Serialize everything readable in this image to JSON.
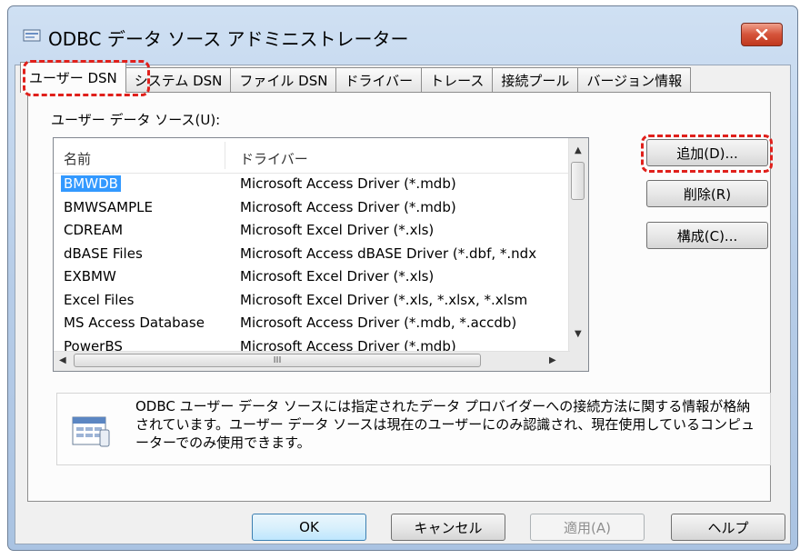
{
  "window": {
    "title": "ODBC データ ソース アドミニストレーター",
    "close_glyph": "✕"
  },
  "tabs": [
    {
      "label": "ユーザー DSN",
      "active": true
    },
    {
      "label": "システム DSN",
      "active": false
    },
    {
      "label": "ファイル DSN",
      "active": false
    },
    {
      "label": "ドライバー",
      "active": false
    },
    {
      "label": "トレース",
      "active": false
    },
    {
      "label": "接続プール",
      "active": false
    },
    {
      "label": "バージョン情報",
      "active": false
    }
  ],
  "section_label": "ユーザー データ ソース(U):",
  "list": {
    "columns": [
      "名前",
      "ドライバー"
    ],
    "rows": [
      {
        "name": "BMWDB",
        "driver": "Microsoft Access Driver (*.mdb)",
        "selected": true
      },
      {
        "name": "BMWSAMPLE",
        "driver": "Microsoft Access Driver (*.mdb)",
        "selected": false
      },
      {
        "name": "CDREAM",
        "driver": "Microsoft Excel Driver (*.xls)",
        "selected": false
      },
      {
        "name": "dBASE Files",
        "driver": "Microsoft Access dBASE Driver (*.dbf, *.ndx",
        "selected": false
      },
      {
        "name": "EXBMW",
        "driver": "Microsoft Excel Driver (*.xls)",
        "selected": false
      },
      {
        "name": "Excel Files",
        "driver": "Microsoft Excel Driver (*.xls, *.xlsx, *.xlsm",
        "selected": false
      },
      {
        "name": "MS Access Database",
        "driver": "Microsoft Access Driver (*.mdb, *.accdb)",
        "selected": false
      },
      {
        "name": "PowerBS",
        "driver": "Microsoft Access Driver (*.mdb)",
        "selected": false
      }
    ],
    "hscroll_thumb_glyph": "III"
  },
  "buttons": {
    "add": "追加(D)...",
    "remove": "削除(R)",
    "configure": "構成(C)..."
  },
  "info_text": "ODBC ユーザー データ ソースには指定されたデータ プロバイダーへの接続方法に関する情報が格納されています。ユーザー データ ソースは現在のユーザーにのみ認識され、現在使用しているコンピューターでのみ使用できます。",
  "footer": {
    "ok": "OK",
    "cancel": "キャンセル",
    "apply": "適用(A)",
    "help": "ヘルプ"
  },
  "colors": {
    "highlight_dash": "#e0201b",
    "selection": "#3399ff",
    "close_button": "#d5533a"
  }
}
